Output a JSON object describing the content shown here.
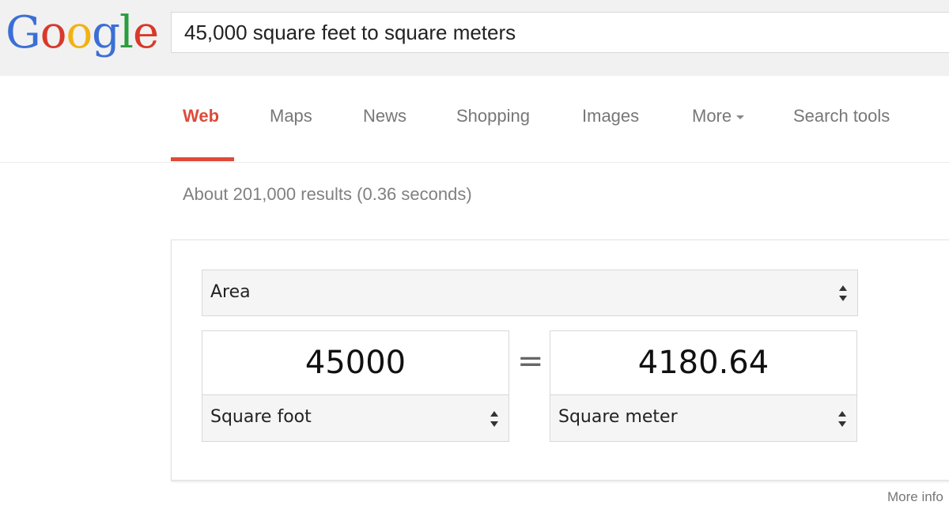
{
  "logo": {
    "letters": [
      {
        "char": "G",
        "color": "#3b6fd6"
      },
      {
        "char": "o",
        "color": "#d8392b"
      },
      {
        "char": "o",
        "color": "#f2b213"
      },
      {
        "char": "g",
        "color": "#3b6fd6"
      },
      {
        "char": "l",
        "color": "#2a9d3f"
      },
      {
        "char": "e",
        "color": "#d8392b"
      }
    ]
  },
  "search": {
    "value": "45,000 square feet to square meters"
  },
  "nav": {
    "tabs": [
      {
        "label": "Web",
        "active": true
      },
      {
        "label": "Maps"
      },
      {
        "label": "News"
      },
      {
        "label": "Shopping"
      },
      {
        "label": "Images"
      },
      {
        "label": "More"
      },
      {
        "label": "Search tools"
      }
    ]
  },
  "result_stats": "About 201,000 results (0.36 seconds)",
  "converter": {
    "category": "Area",
    "from_value": "45000",
    "from_unit": "Square foot",
    "equals": "=",
    "to_value": "4180.64",
    "to_unit": "Square meter"
  },
  "more_info": "More info",
  "colors": {
    "accent": "#dd4b39",
    "header_bg": "#f1f1f1"
  }
}
